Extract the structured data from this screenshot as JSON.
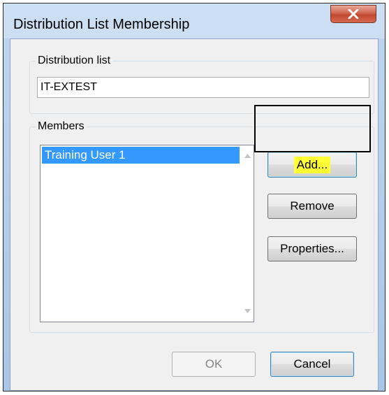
{
  "window": {
    "title": "Distribution List Membership",
    "close_icon": "close-x-icon"
  },
  "distribution_list": {
    "group_label": "Distribution list",
    "value": "IT-EXTEST"
  },
  "members": {
    "group_label": "Members",
    "items": [
      "Training User 1"
    ],
    "selected_index": 0,
    "scroll_up_icon": "scroll-up-arrow-icon",
    "scroll_down_icon": "scroll-down-arrow-icon"
  },
  "buttons": {
    "add": "Add...",
    "remove": "Remove",
    "properties": "Properties...",
    "ok": "OK",
    "cancel": "Cancel"
  },
  "colors": {
    "selection": "#3399ff",
    "highlight": "#ffff33",
    "close_button": "#c24730"
  }
}
